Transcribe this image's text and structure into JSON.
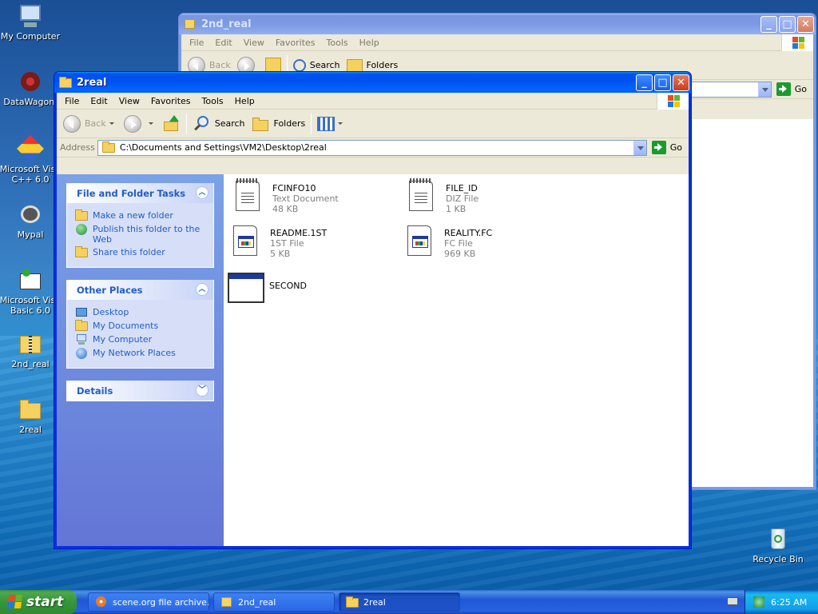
{
  "desktop": {
    "icons": [
      {
        "label": "My Computer"
      },
      {
        "label": "DataWagon."
      },
      {
        "label": "Microsoft Visu C++ 6.0"
      },
      {
        "label": "Mypal"
      },
      {
        "label": "Microsoft Visu Basic 6.0"
      },
      {
        "label": "2nd_real"
      },
      {
        "label": "2real"
      },
      {
        "label": "Recycle Bin"
      }
    ]
  },
  "back_window": {
    "title": "2nd_real",
    "menu": [
      "File",
      "Edit",
      "View",
      "Favorites",
      "Tools",
      "Help"
    ],
    "toolbar": {
      "back": "Back",
      "search": "Search",
      "folders": "Folders"
    },
    "go_label": "Go"
  },
  "front_window": {
    "title": "2real",
    "menu": [
      "File",
      "Edit",
      "View",
      "Favorites",
      "Tools",
      "Help"
    ],
    "toolbar": {
      "back": "Back",
      "search": "Search",
      "folders": "Folders"
    },
    "address": {
      "label": "Address",
      "value": "C:\\Documents and Settings\\VM2\\Desktop\\2real",
      "go": "Go"
    },
    "task_pane": {
      "file_tasks": {
        "title": "File and Folder Tasks",
        "items": [
          "Make a new folder",
          "Publish this folder to the Web",
          "Share this folder"
        ]
      },
      "other_places": {
        "title": "Other Places",
        "items": [
          "Desktop",
          "My Documents",
          "My Computer",
          "My Network Places"
        ]
      },
      "details": {
        "title": "Details"
      }
    },
    "files": [
      {
        "name": "FCINFO10",
        "type": "Text Document",
        "size": "48 KB",
        "icon": "notepad-doc-icon"
      },
      {
        "name": "FILE_ID",
        "type": "DIZ File",
        "size": "1 KB",
        "icon": "notepad-doc-icon"
      },
      {
        "name": "README.1ST",
        "type": "1ST File",
        "size": "5 KB",
        "icon": "generic-file-icon"
      },
      {
        "name": "REALITY.FC",
        "type": "FC File",
        "size": "969 KB",
        "icon": "generic-file-icon"
      },
      {
        "name": "SECOND",
        "icon": "application-icon"
      }
    ]
  },
  "taskbar": {
    "start": "start",
    "buttons": [
      {
        "label": "scene.org file archive..."
      },
      {
        "label": "2nd_real"
      },
      {
        "label": "2real"
      }
    ],
    "clock": "6:25 AM"
  }
}
